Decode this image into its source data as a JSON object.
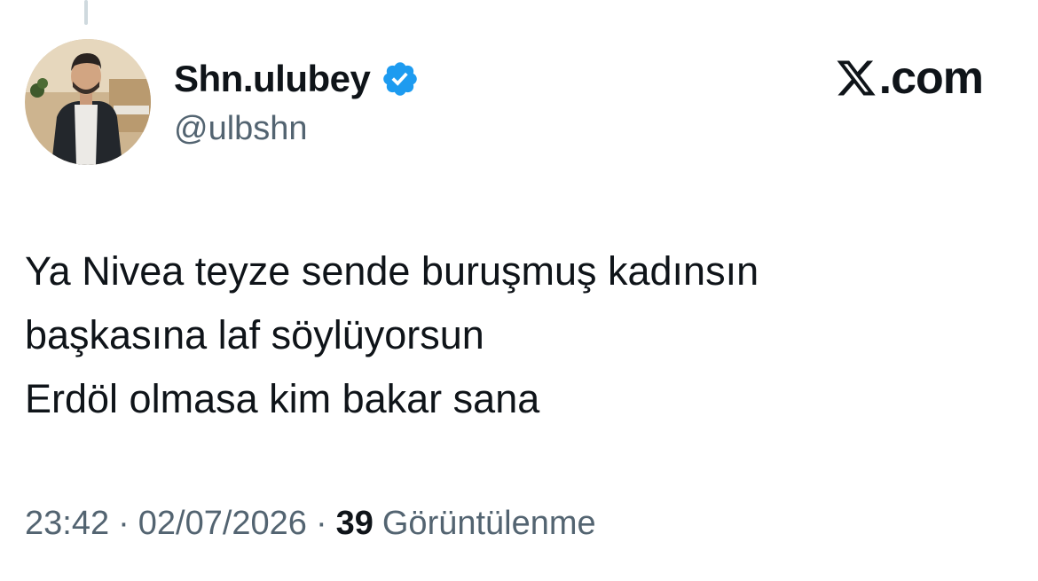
{
  "author": {
    "display_name": "Shn.ulubey",
    "handle": "@ulbshn",
    "verified": true,
    "verified_color": "#1d9bf0"
  },
  "brand": {
    "icon": "x-logo-icon",
    "domain": ".com"
  },
  "tweet": {
    "lines": [
      "Ya Nivea teyze sende buruşmuş kadınsın",
      "başkasına laf söylüyorsun",
      "Erdöl olmasa kim bakar sana"
    ]
  },
  "meta": {
    "time": "23:42",
    "date": "02/07/2026",
    "separator": "·",
    "views_count": "39",
    "views_label": "Görüntülenme"
  },
  "colors": {
    "text_primary": "#0f1419",
    "text_secondary": "#536471",
    "thread_line": "#cfd9de"
  }
}
